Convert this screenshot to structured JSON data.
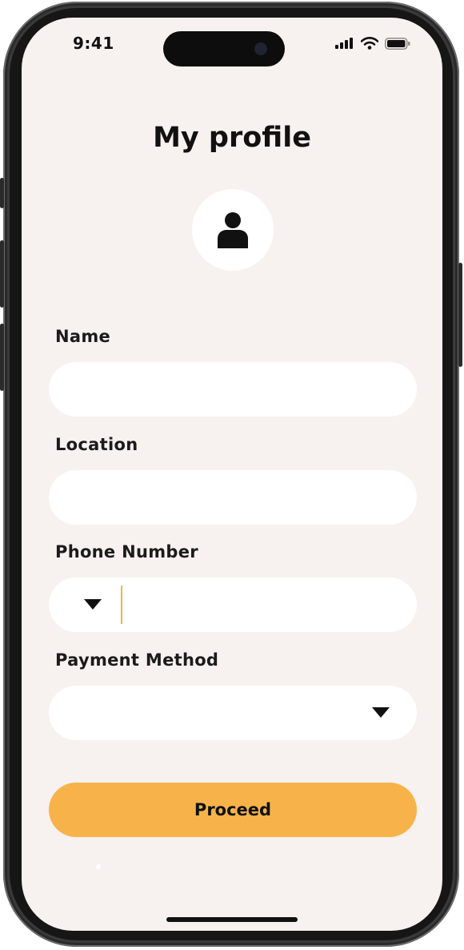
{
  "status_bar": {
    "time": "9:41"
  },
  "screen": {
    "title": "My profile"
  },
  "form": {
    "name": {
      "label": "Name",
      "value": "",
      "placeholder": ""
    },
    "location": {
      "label": "Location",
      "value": "",
      "placeholder": ""
    },
    "phone": {
      "label": "Phone Number",
      "value": "",
      "country_code": ""
    },
    "payment": {
      "label": "Payment Method",
      "selected": ""
    }
  },
  "actions": {
    "proceed_label": "Proceed"
  },
  "colors": {
    "background": "#f7f1ef",
    "accent": "#f7b349",
    "field": "#ffffff",
    "text": "#111111"
  },
  "icons": {
    "avatar": "user-icon",
    "dropdown": "caret-down-icon",
    "signal": "cellular-signal-icon",
    "wifi": "wifi-icon",
    "battery": "battery-icon"
  }
}
